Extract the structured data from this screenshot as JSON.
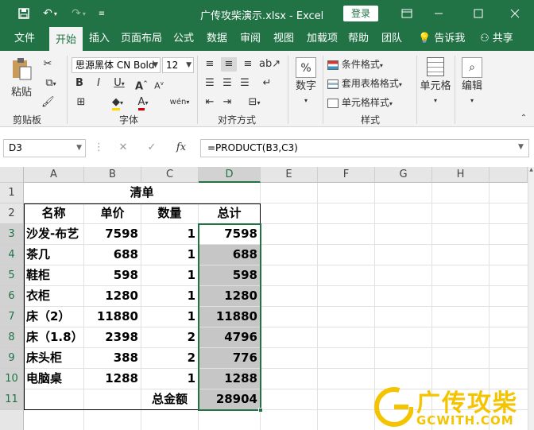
{
  "window": {
    "title": "广传攻柴演示.xlsx  -  Excel",
    "login": "登录"
  },
  "tabs": [
    "文件",
    "开始",
    "插入",
    "页面布局",
    "公式",
    "数据",
    "审阅",
    "视图",
    "加载项",
    "帮助",
    "团队"
  ],
  "tell_me": "告诉我",
  "share": "共享",
  "ribbon": {
    "clipboard": {
      "paste": "粘贴",
      "label": "剪贴板"
    },
    "font": {
      "name": "思源黑体 CN Bold",
      "size": "12",
      "label": "字体"
    },
    "align": {
      "label": "对齐方式"
    },
    "number": {
      "btn": "数字"
    },
    "styles": {
      "cond": "条件格式",
      "table": "套用表格格式",
      "cell": "单元格样式",
      "label": "样式"
    },
    "cells": {
      "btn": "单元格"
    },
    "edit": {
      "btn": "编辑"
    }
  },
  "formula_bar": {
    "name_box": "D3",
    "formula": "=PRODUCT(B3,C3)"
  },
  "sheet": {
    "columns": [
      "A",
      "B",
      "C",
      "D",
      "E",
      "F",
      "G",
      "H"
    ],
    "rows": [
      "1",
      "2",
      "3",
      "4",
      "5",
      "6",
      "7",
      "8",
      "9",
      "10",
      "11"
    ],
    "title": "清单",
    "headers": [
      "名称",
      "单价",
      "数量",
      "总计"
    ],
    "data": [
      [
        "沙发-布艺",
        "7598",
        "1",
        "7598"
      ],
      [
        "茶几",
        "688",
        "1",
        "688"
      ],
      [
        "鞋柜",
        "598",
        "1",
        "598"
      ],
      [
        "衣柜",
        "1280",
        "1",
        "1280"
      ],
      [
        "床（2）",
        "11880",
        "1",
        "11880"
      ],
      [
        "床（1.8）",
        "2398",
        "2",
        "4796"
      ],
      [
        "床头柜",
        "388",
        "2",
        "776"
      ],
      [
        "电脑桌",
        "1288",
        "1",
        "1288"
      ]
    ],
    "total_label": "总金额",
    "total_value": "28904"
  },
  "watermark": {
    "text": "广传攻柴",
    "url": "GCWITH.COM",
    "color": "#f5c400"
  },
  "colors": {
    "accent": "#217346"
  }
}
